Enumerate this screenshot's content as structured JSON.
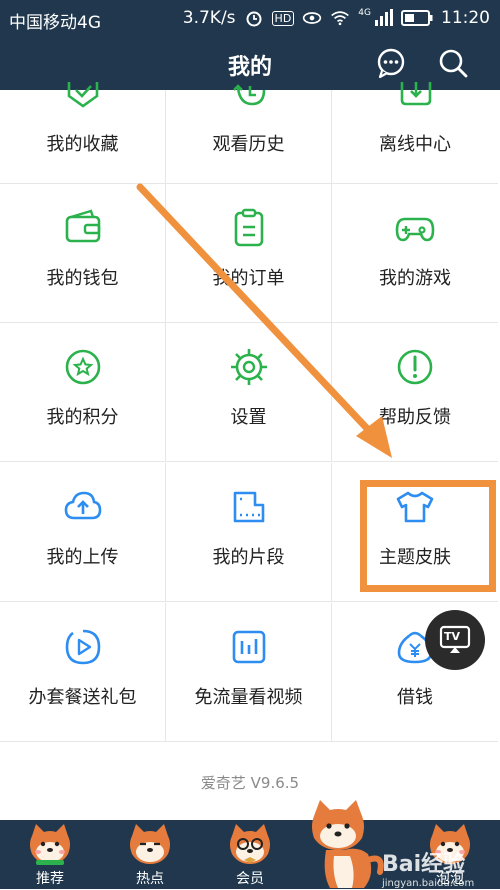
{
  "status_bar": {
    "carrier": "中国移动4G",
    "speed": "3.7K/s",
    "hd": "HD",
    "net": "4G",
    "time": "11:20"
  },
  "header": {
    "title": "我的",
    "icons": [
      "message-icon",
      "search-icon"
    ]
  },
  "grid": {
    "row0": [
      "我的收藏",
      "观看历史",
      "离线中心"
    ],
    "row1": [
      "我的钱包",
      "我的订单",
      "我的游戏"
    ],
    "row2": [
      "我的积分",
      "设置",
      "帮助反馈"
    ],
    "row3": [
      "我的上传",
      "我的片段",
      "主题皮肤"
    ],
    "row4": [
      "办套餐送礼包",
      "免流量看视频",
      "借钱"
    ]
  },
  "version": "爱奇艺 V9.6.5",
  "tabs": [
    "推荐",
    "热点",
    "会员",
    "",
    "泡泡"
  ],
  "tv_button": "TV",
  "watermark": {
    "text": "Bai经验",
    "sub": "jingyan.baidu.com"
  },
  "colors": {
    "bar": "#20374d",
    "green": "#2bb24c",
    "blue": "#2e8df0",
    "orange": "#f0913d"
  }
}
